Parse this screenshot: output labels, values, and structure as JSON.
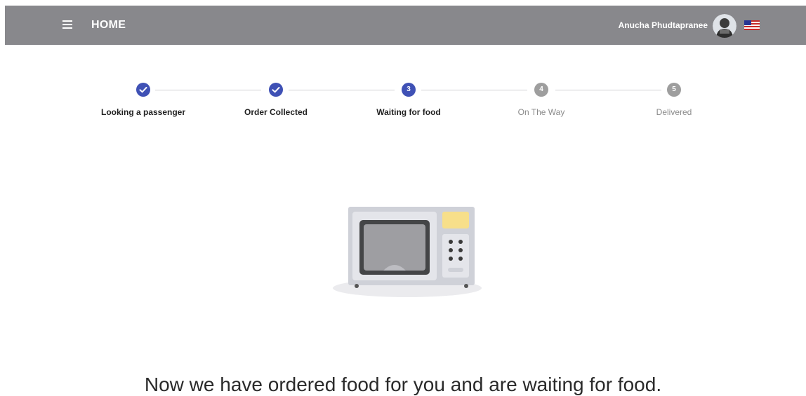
{
  "header": {
    "title": "HOME",
    "user_name": "Anucha Phudtapranee"
  },
  "stepper": {
    "steps": [
      {
        "label": "Looking a passenger",
        "number": "1",
        "state": "done"
      },
      {
        "label": "Order Collected",
        "number": "2",
        "state": "done"
      },
      {
        "label": "Waiting for food",
        "number": "3",
        "state": "active"
      },
      {
        "label": "On The Way",
        "number": "4",
        "state": "pending"
      },
      {
        "label": "Delivered",
        "number": "5",
        "state": "pending"
      }
    ]
  },
  "main": {
    "message": "Now we have ordered food for you and are waiting for food."
  },
  "colors": {
    "header_bg": "#88888c",
    "step_done": "#3f51b5",
    "step_pending": "#9e9e9e"
  }
}
